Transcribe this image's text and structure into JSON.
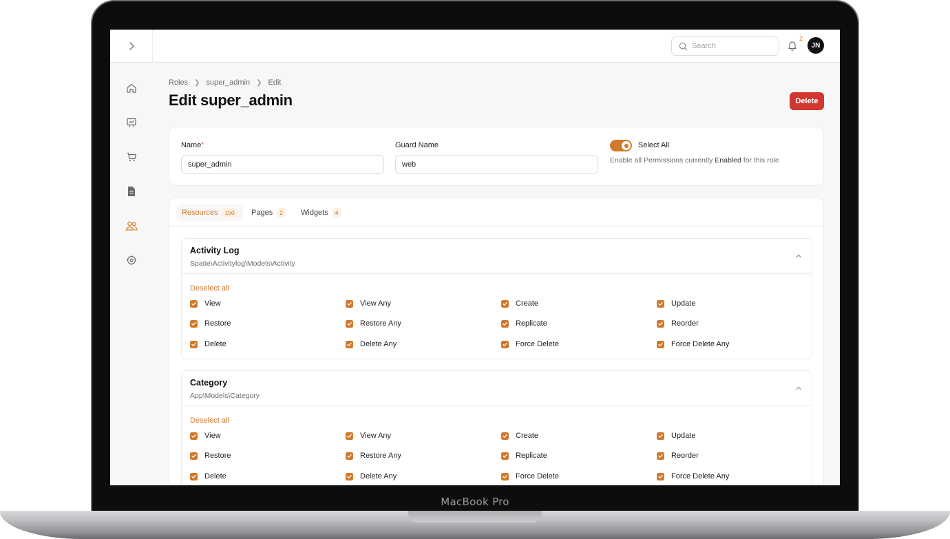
{
  "device": {
    "label": "MacBook Pro"
  },
  "topbar": {
    "search_placeholder": "Search",
    "notification_count": "2",
    "avatar_initials": "JN"
  },
  "sidebar": {
    "items": [
      {
        "icon": "home-icon"
      },
      {
        "icon": "presentation-chart-icon"
      },
      {
        "icon": "shopping-cart-icon"
      },
      {
        "icon": "document-icon"
      },
      {
        "icon": "users-icon",
        "active": true
      },
      {
        "icon": "settings-cog-icon"
      }
    ]
  },
  "breadcrumb": [
    "Roles",
    "super_admin",
    "Edit"
  ],
  "page": {
    "title": "Edit super_admin",
    "delete_label": "Delete"
  },
  "form": {
    "name_label": "Name",
    "name_required": "*",
    "name_value": "super_admin",
    "guard_label": "Guard Name",
    "guard_value": "web",
    "select_all_label": "Select All",
    "select_all_hint_pre": "Enable all Permissions currently",
    "select_all_hint_bold": "Enabled",
    "select_all_hint_post": "for this role",
    "select_all_on": true
  },
  "tabs": [
    {
      "label": "Resources",
      "count": "150",
      "active": true
    },
    {
      "label": "Pages",
      "count": "2"
    },
    {
      "label": "Widgets",
      "count": "4"
    }
  ],
  "sections": [
    {
      "title": "Activity Log",
      "subtitle": "Spatie\\Activitylog\\Models\\Activity",
      "deselect_label": "Deselect all",
      "permissions": [
        "View",
        "View Any",
        "Create",
        "Update",
        "Restore",
        "Restore Any",
        "Replicate",
        "Reorder",
        "Delete",
        "Delete Any",
        "Force Delete",
        "Force Delete Any"
      ]
    },
    {
      "title": "Category",
      "subtitle": "App\\Models\\Category",
      "deselect_label": "Deselect all",
      "permissions": [
        "View",
        "View Any",
        "Create",
        "Update",
        "Restore",
        "Restore Any",
        "Replicate",
        "Reorder",
        "Delete",
        "Delete Any",
        "Force Delete",
        "Force Delete Any"
      ]
    }
  ],
  "colors": {
    "accent": "#d0792a",
    "danger": "#d1362f"
  }
}
